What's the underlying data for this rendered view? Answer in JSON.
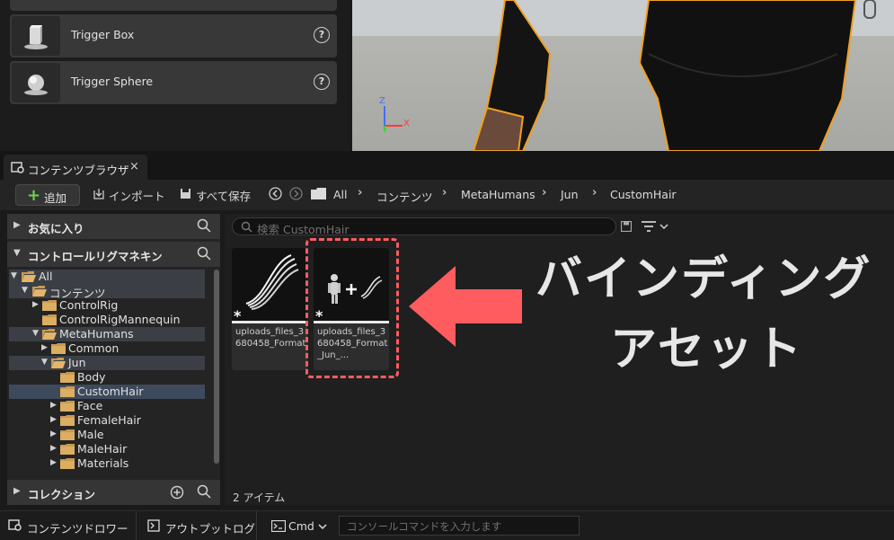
{
  "place_actors": {
    "items": [
      {
        "label": "Trigger Box"
      },
      {
        "label": "Trigger Sphere"
      }
    ]
  },
  "viewport": {
    "axis_z": "Z",
    "axis_y": "Y",
    "axis_x": "X"
  },
  "tab": {
    "label": "コンテンツブラウザ",
    "close": "×"
  },
  "toolbar": {
    "add_label": "追加",
    "import_label": "インポート",
    "save_all_label": "すべて保存",
    "breadcrumb": [
      "All",
      "コンテンツ",
      "MetaHumans",
      "Jun",
      "CustomHair"
    ]
  },
  "sidebar": {
    "favorites": "お気に入り",
    "collection_header": "コントロールリグマネキン",
    "collections": "コレクション",
    "tree": [
      {
        "label": "All"
      },
      {
        "label": "コンテンツ"
      },
      {
        "label": "ControlRig"
      },
      {
        "label": "ControlRigMannequin"
      },
      {
        "label": "MetaHumans"
      },
      {
        "label": "Common"
      },
      {
        "label": "Jun"
      },
      {
        "label": "Body"
      },
      {
        "label": "CustomHair"
      },
      {
        "label": "Face"
      },
      {
        "label": "FemaleHair"
      },
      {
        "label": "Male"
      },
      {
        "label": "MaleHair"
      },
      {
        "label": "Materials"
      }
    ]
  },
  "assets": {
    "search_placeholder": "検索 CustomHair",
    "items": [
      {
        "name": "uploads_files_3680458_Format",
        "star": "*"
      },
      {
        "name": "uploads_files_3680458_Format_Jun_...",
        "star": "*"
      }
    ],
    "count": "2 アイテム"
  },
  "annotation": {
    "line1": "バインディング",
    "line2": "アセット",
    "color": "#ff5c60"
  },
  "bottom": {
    "drawer": "コンテンツドロワー",
    "output_log": "アウトプットログ",
    "cmd": "Cmd",
    "console_placeholder": "コンソールコマンドを入力します"
  }
}
